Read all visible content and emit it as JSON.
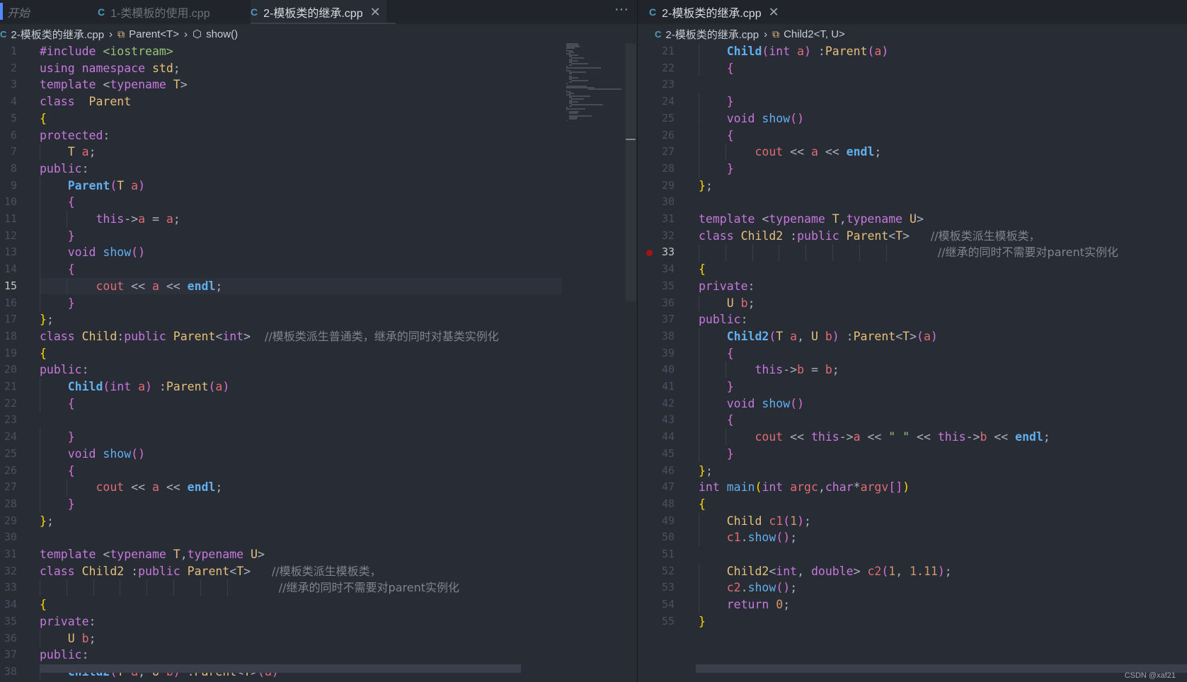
{
  "left": {
    "tabs": [
      {
        "label": "开始"
      },
      {
        "label": "1-类模板的使用.cpp"
      },
      {
        "label": "2-模板类的继承.cpp"
      }
    ],
    "more_label": "···",
    "breadcrumb": {
      "file": "2-模板类的继承.cpp",
      "class": "Parent<T>",
      "method": "show()"
    },
    "first_line": 1,
    "current_line": 15
  },
  "right": {
    "tab": {
      "label": "2-模板类的继承.cpp"
    },
    "breadcrumb": {
      "file": "2-模板类的继承.cpp",
      "class": "Child2<T, U>"
    },
    "first_line": 21,
    "breakpoint_line": 33
  },
  "icons": {
    "file_icon": "C",
    "close_icon": "✕",
    "chevron_icon": "›",
    "template_icon": "⧉",
    "cube_icon": "⬡"
  },
  "watermark": "CSDN @xaf21",
  "code_lines": [
    [
      [
        "kw",
        "#include "
      ],
      [
        "inc",
        "<iostream>"
      ]
    ],
    [
      [
        "kw",
        "using namespace "
      ],
      [
        "ty",
        "std"
      ],
      [
        "pc",
        ";"
      ]
    ],
    [
      [
        "kw",
        "template "
      ],
      [
        "pc",
        "<"
      ],
      [
        "kw",
        "typename "
      ],
      [
        "ty",
        "T"
      ],
      [
        "pc",
        ">"
      ]
    ],
    [
      [
        "kw",
        "class  "
      ],
      [
        "ty",
        "Parent"
      ]
    ],
    [
      [
        "br1",
        "{"
      ]
    ],
    [
      [
        "kw",
        "protected"
      ],
      [
        "pc",
        ":"
      ]
    ],
    [
      [
        "pc",
        "    "
      ],
      [
        "ty",
        "T "
      ],
      [
        "vr",
        "a"
      ],
      [
        "pc",
        ";"
      ]
    ],
    [
      [
        "kw",
        "public"
      ],
      [
        "pc",
        ":"
      ]
    ],
    [
      [
        "pc",
        "    "
      ],
      [
        "fnb",
        "Parent"
      ],
      [
        "br2",
        "("
      ],
      [
        "ty",
        "T "
      ],
      [
        "vr",
        "a"
      ],
      [
        "br2",
        ")"
      ]
    ],
    [
      [
        "pc",
        "    "
      ],
      [
        "br2",
        "{"
      ]
    ],
    [
      [
        "pc",
        "        "
      ],
      [
        "kw",
        "this"
      ],
      [
        "pc",
        "->"
      ],
      [
        "vr",
        "a"
      ],
      [
        "pc",
        " = "
      ],
      [
        "vr",
        "a"
      ],
      [
        "pc",
        ";"
      ]
    ],
    [
      [
        "pc",
        "    "
      ],
      [
        "br2",
        "}"
      ]
    ],
    [
      [
        "pc",
        "    "
      ],
      [
        "kw",
        "void "
      ],
      [
        "fn",
        "show"
      ],
      [
        "br2",
        "()"
      ]
    ],
    [
      [
        "pc",
        "    "
      ],
      [
        "br2",
        "{"
      ]
    ],
    [
      [
        "pc",
        "        "
      ],
      [
        "vr",
        "cout"
      ],
      [
        "pc",
        " << "
      ],
      [
        "vr",
        "a"
      ],
      [
        "pc",
        " << "
      ],
      [
        "fnb",
        "endl"
      ],
      [
        "pc",
        ";"
      ]
    ],
    [
      [
        "pc",
        "    "
      ],
      [
        "br2",
        "}"
      ]
    ],
    [
      [
        "br1",
        "}"
      ],
      [
        "pc",
        ";"
      ]
    ],
    [
      [
        "kw",
        "class "
      ],
      [
        "ty",
        "Child"
      ],
      [
        "pc",
        ":"
      ],
      [
        "kw",
        "public "
      ],
      [
        "ty",
        "Parent"
      ],
      [
        "pc",
        "<"
      ],
      [
        "kw",
        "int"
      ],
      [
        "pc",
        ">  "
      ],
      [
        "cm",
        "//模板类派生普通类，继承的同时对基类实例化"
      ]
    ],
    [
      [
        "br1",
        "{"
      ]
    ],
    [
      [
        "kw",
        "public"
      ],
      [
        "pc",
        ":"
      ]
    ],
    [
      [
        "pc",
        "    "
      ],
      [
        "fnb",
        "Child"
      ],
      [
        "br2",
        "("
      ],
      [
        "kw",
        "int "
      ],
      [
        "vr",
        "a"
      ],
      [
        "br2",
        ")"
      ],
      [
        "pc",
        " :"
      ],
      [
        "ty",
        "Parent"
      ],
      [
        "br2",
        "("
      ],
      [
        "vr",
        "a"
      ],
      [
        "br2",
        ")"
      ]
    ],
    [
      [
        "pc",
        "    "
      ],
      [
        "br2",
        "{"
      ]
    ],
    [
      [
        "pc",
        ""
      ]
    ],
    [
      [
        "pc",
        "    "
      ],
      [
        "br2",
        "}"
      ]
    ],
    [
      [
        "pc",
        "    "
      ],
      [
        "kw",
        "void "
      ],
      [
        "fn",
        "show"
      ],
      [
        "br2",
        "()"
      ]
    ],
    [
      [
        "pc",
        "    "
      ],
      [
        "br2",
        "{"
      ]
    ],
    [
      [
        "pc",
        "        "
      ],
      [
        "vr",
        "cout"
      ],
      [
        "pc",
        " << "
      ],
      [
        "vr",
        "a"
      ],
      [
        "pc",
        " << "
      ],
      [
        "fnb",
        "endl"
      ],
      [
        "pc",
        ";"
      ]
    ],
    [
      [
        "pc",
        "    "
      ],
      [
        "br2",
        "}"
      ]
    ],
    [
      [
        "br1",
        "}"
      ],
      [
        "pc",
        ";"
      ]
    ],
    [
      [
        "pc",
        ""
      ]
    ],
    [
      [
        "kw",
        "template "
      ],
      [
        "pc",
        "<"
      ],
      [
        "kw",
        "typename "
      ],
      [
        "ty",
        "T"
      ],
      [
        "pc",
        ","
      ],
      [
        "kw",
        "typename "
      ],
      [
        "ty",
        "U"
      ],
      [
        "pc",
        ">"
      ]
    ],
    [
      [
        "kw",
        "class "
      ],
      [
        "ty",
        "Child2"
      ],
      [
        "pc",
        " :"
      ],
      [
        "kw",
        "public "
      ],
      [
        "ty",
        "Parent"
      ],
      [
        "pc",
        "<"
      ],
      [
        "ty",
        "T"
      ],
      [
        "pc",
        ">   "
      ],
      [
        "cm",
        "//模板类派生模板类，"
      ]
    ],
    [
      [
        "pc",
        "                                  "
      ],
      [
        "cm",
        "//继承的同时不需要对parent实例化"
      ]
    ],
    [
      [
        "br1",
        "{"
      ]
    ],
    [
      [
        "kw",
        "private"
      ],
      [
        "pc",
        ":"
      ]
    ],
    [
      [
        "pc",
        "    "
      ],
      [
        "ty",
        "U "
      ],
      [
        "vr",
        "b"
      ],
      [
        "pc",
        ";"
      ]
    ],
    [
      [
        "kw",
        "public"
      ],
      [
        "pc",
        ":"
      ]
    ],
    [
      [
        "pc",
        "    "
      ],
      [
        "fnb",
        "Child2"
      ],
      [
        "br2",
        "("
      ],
      [
        "ty",
        "T "
      ],
      [
        "vr",
        "a"
      ],
      [
        "pc",
        ", "
      ],
      [
        "ty",
        "U "
      ],
      [
        "vr",
        "b"
      ],
      [
        "br2",
        ")"
      ],
      [
        "pc",
        " :"
      ],
      [
        "ty",
        "Parent"
      ],
      [
        "pc",
        "<"
      ],
      [
        "ty",
        "T"
      ],
      [
        "pc",
        ">"
      ],
      [
        "br2",
        "("
      ],
      [
        "vr",
        "a"
      ],
      [
        "br2",
        ")"
      ]
    ],
    [
      [
        "pc",
        "    "
      ],
      [
        "br2",
        "{"
      ]
    ],
    [
      [
        "pc",
        "        "
      ],
      [
        "kw",
        "this"
      ],
      [
        "pc",
        "->"
      ],
      [
        "vr",
        "b"
      ],
      [
        "pc",
        " = "
      ],
      [
        "vr",
        "b"
      ],
      [
        "pc",
        ";"
      ]
    ],
    [
      [
        "pc",
        "    "
      ],
      [
        "br2",
        "}"
      ]
    ],
    [
      [
        "pc",
        "    "
      ],
      [
        "kw",
        "void "
      ],
      [
        "fn",
        "show"
      ],
      [
        "br2",
        "()"
      ]
    ],
    [
      [
        "pc",
        "    "
      ],
      [
        "br2",
        "{"
      ]
    ],
    [
      [
        "pc",
        "        "
      ],
      [
        "vr",
        "cout"
      ],
      [
        "pc",
        " << "
      ],
      [
        "kw",
        "this"
      ],
      [
        "pc",
        "->"
      ],
      [
        "vr",
        "a"
      ],
      [
        "pc",
        " << "
      ],
      [
        "st",
        "\" \""
      ],
      [
        "pc",
        " << "
      ],
      [
        "kw",
        "this"
      ],
      [
        "pc",
        "->"
      ],
      [
        "vr",
        "b"
      ],
      [
        "pc",
        " << "
      ],
      [
        "fnb",
        "endl"
      ],
      [
        "pc",
        ";"
      ]
    ],
    [
      [
        "pc",
        "    "
      ],
      [
        "br2",
        "}"
      ]
    ],
    [
      [
        "br1",
        "}"
      ],
      [
        "pc",
        ";"
      ]
    ],
    [
      [
        "kw",
        "int "
      ],
      [
        "fn",
        "main"
      ],
      [
        "br1",
        "("
      ],
      [
        "kw",
        "int "
      ],
      [
        "vr",
        "argc"
      ],
      [
        "pc",
        ","
      ],
      [
        "kw",
        "char"
      ],
      [
        "pc",
        "*"
      ],
      [
        "vr",
        "argv"
      ],
      [
        "br2",
        "[]"
      ],
      [
        "br1",
        ")"
      ]
    ],
    [
      [
        "br1",
        "{"
      ]
    ],
    [
      [
        "pc",
        "    "
      ],
      [
        "ty",
        "Child "
      ],
      [
        "vr",
        "c1"
      ],
      [
        "br2",
        "("
      ],
      [
        "nu",
        "1"
      ],
      [
        "br2",
        ")"
      ],
      [
        "pc",
        ";"
      ]
    ],
    [
      [
        "pc",
        "    "
      ],
      [
        "vr",
        "c1"
      ],
      [
        "pc",
        "."
      ],
      [
        "fn",
        "show"
      ],
      [
        "br2",
        "()"
      ],
      [
        "pc",
        ";"
      ]
    ],
    [
      [
        "pc",
        ""
      ]
    ],
    [
      [
        "pc",
        "    "
      ],
      [
        "ty",
        "Child2"
      ],
      [
        "pc",
        "<"
      ],
      [
        "kw",
        "int"
      ],
      [
        "pc",
        ", "
      ],
      [
        "kw",
        "double"
      ],
      [
        "pc",
        "> "
      ],
      [
        "vr",
        "c2"
      ],
      [
        "br2",
        "("
      ],
      [
        "nu",
        "1"
      ],
      [
        "pc",
        ", "
      ],
      [
        "nu",
        "1.11"
      ],
      [
        "br2",
        ")"
      ],
      [
        "pc",
        ";"
      ]
    ],
    [
      [
        "pc",
        "    "
      ],
      [
        "vr",
        "c2"
      ],
      [
        "pc",
        "."
      ],
      [
        "fn",
        "show"
      ],
      [
        "br2",
        "()"
      ],
      [
        "pc",
        ";"
      ]
    ],
    [
      [
        "pc",
        "    "
      ],
      [
        "kw",
        "return "
      ],
      [
        "nu",
        "0"
      ],
      [
        "pc",
        ";"
      ]
    ],
    [
      [
        "br1",
        "}"
      ]
    ]
  ]
}
